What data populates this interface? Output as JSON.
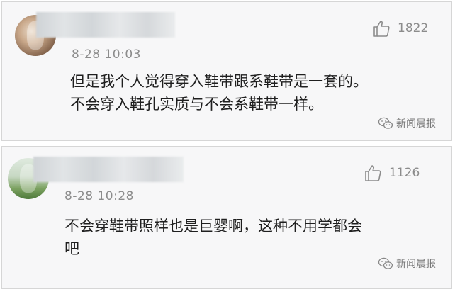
{
  "comments": [
    {
      "time": "8-28 10:03",
      "likes": "1822",
      "text_line1": "但是我个人觉得穿入鞋带跟系鞋带是一套的。",
      "text_line2": "不会穿入鞋孔实质与不会系鞋带一样。",
      "watermark": "新闻晨报"
    },
    {
      "time": "8-28 10:28",
      "likes": "1126",
      "text_line1": "不会穿鞋带照样也是巨婴啊，这种不用学都会",
      "text_line2": "吧",
      "watermark": "新闻晨报"
    }
  ],
  "icons": {
    "like": "thumbs-up-icon",
    "watermark": "wechat-icon",
    "avatar_blurred": "avatar"
  }
}
